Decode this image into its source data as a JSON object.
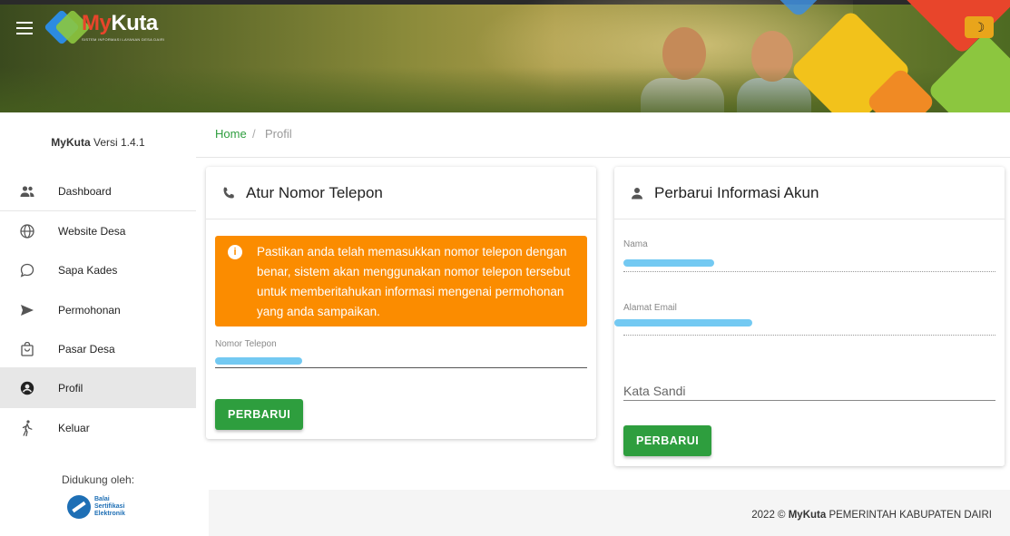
{
  "header": {
    "brand_my": "My",
    "brand_kuta": "Kuta",
    "brand_tagline": "SISTEM INFORMASI LAYANAN DESA DAIRI",
    "theme_toggle_glyph": "☽",
    "colors": {
      "accent": "#2e9e3e",
      "alert": "#fb8c00",
      "theme_button": "#e9a51b"
    }
  },
  "sidebar": {
    "version_brand": "MyKuta",
    "version_text": " Versi 1.4.1",
    "items": [
      {
        "label": "Dashboard",
        "icon": "users-icon"
      },
      {
        "label": "Website Desa",
        "icon": "globe-icon"
      },
      {
        "label": "Sapa Kades",
        "icon": "chat-bubble-icon"
      },
      {
        "label": "Permohonan",
        "icon": "send-icon"
      },
      {
        "label": "Pasar Desa",
        "icon": "shopping-bag-icon"
      },
      {
        "label": "Profil",
        "icon": "account-circle-icon",
        "active": true
      },
      {
        "label": "Keluar",
        "icon": "walking-person-icon"
      }
    ],
    "supported_by": "Didukung oleh:",
    "partner_line1": "Balai",
    "partner_line2": "Sertifikasi",
    "partner_line3": "Elektronik"
  },
  "breadcrumb": {
    "home": "Home",
    "separator": "/",
    "current": "Profil"
  },
  "phone_card": {
    "title": "Atur Nomor Telepon",
    "alert_text": "Pastikan anda telah memasukkan nomor telepon dengan benar, sistem akan menggunakan nomor telepon tersebut untuk memberitahukan informasi mengenai permohonan yang anda sampaikan.",
    "phone_label": "Nomor Telepon",
    "button": "PERBARUI"
  },
  "account_card": {
    "title": "Perbarui Informasi Akun",
    "name_label": "Nama",
    "email_label": "Alamat Email",
    "password_placeholder": "Kata Sandi",
    "button": "PERBARUI"
  },
  "footer": {
    "year": "2022 © ",
    "brand": "MyKuta",
    "text": " PEMERINTAH KABUPATEN DAIRI"
  }
}
